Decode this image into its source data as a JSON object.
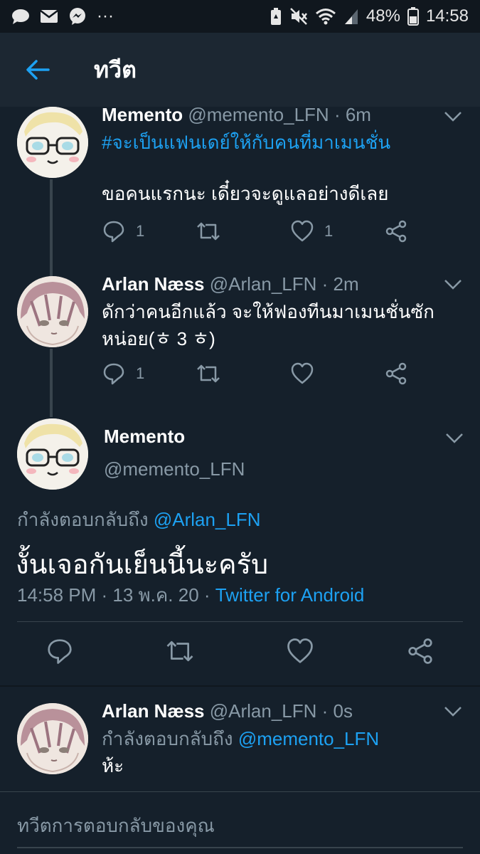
{
  "status_bar": {
    "battery": "48%",
    "time": "14:58",
    "dots": "···"
  },
  "header": {
    "title": "ทวีต"
  },
  "tweets": [
    {
      "name": "Memento",
      "handle": "@memento_LFN",
      "time": "· 6m",
      "hashtag": "#จะเป็นแฟนเดย์ให้กับคนที่มาเมนชั่น",
      "text": "ขอคนแรกนะ เดี๋ยวจะดูแลอย่างดีเลย",
      "reply_count": "1",
      "like_count": "1"
    },
    {
      "name": "Arlan Næss",
      "handle": "@Arlan_LFN",
      "time": "· 2m",
      "text_line1": "ดักว่าคนอีกแล้ว จะให้ฟองทีนมาเมนชั่นซัก",
      "text_line2": "หน่อย(ㅎ 3 ㅎ)",
      "reply_count": "1"
    }
  ],
  "focused_tweet": {
    "name": "Memento",
    "handle": "@memento_LFN",
    "replying_label": "กำลังตอบกลับถึง",
    "replying_to": "@Arlan_LFN",
    "text": "งั้นเจอกันเย็นนี้นะครับ",
    "timestamp": "14:58 PM · 13 พ.ค. 20 ·",
    "source": "Twitter for Android"
  },
  "reply_tweet": {
    "name": "Arlan Næss",
    "handle": "@Arlan_LFN",
    "time": "· 0s",
    "replying_label": "กำลังตอบกลับถึง",
    "replying_to": "@memento_LFN",
    "text": "ห้ะ"
  },
  "composer": {
    "placeholder": "ทวีตการตอบกลับของคุณ"
  },
  "colors": {
    "background": "#15202b",
    "header": "#1c2732",
    "accent": "#1da1f2",
    "secondary_text": "#8899a6",
    "divider": "#38444d"
  }
}
